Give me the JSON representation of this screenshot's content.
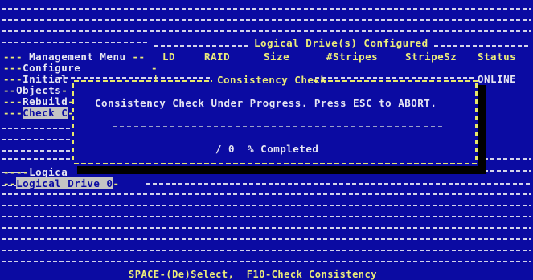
{
  "menu": {
    "title": "Management Menu",
    "items": [
      "Configure",
      "Initial",
      "Objects",
      "Rebuild",
      "Check C"
    ],
    "selected_index": 4
  },
  "drives_panel": {
    "title": "Logical Drive(s) Configured",
    "headers": [
      "LD",
      "RAID",
      "Size",
      "#Stripes",
      "StripeSz",
      "Status"
    ],
    "status_value": "ONLINE"
  },
  "dialog": {
    "title": "Consistency Check",
    "message": "Consistency Check Under Progress. Press ESC to ABORT.",
    "progress_text": "/ 0  % Completed",
    "progress_percent": 0
  },
  "logical_menu": {
    "title": "Logica",
    "selected_item": "Logical Drive 0"
  },
  "footer": {
    "hint": "SPACE-(De)Select,  F10-Check Consistency"
  },
  "colors": {
    "background": "#0b0ba2",
    "text": "#e6e6f2",
    "accent": "#ecec7a",
    "highlight": "#c4c4c4"
  }
}
